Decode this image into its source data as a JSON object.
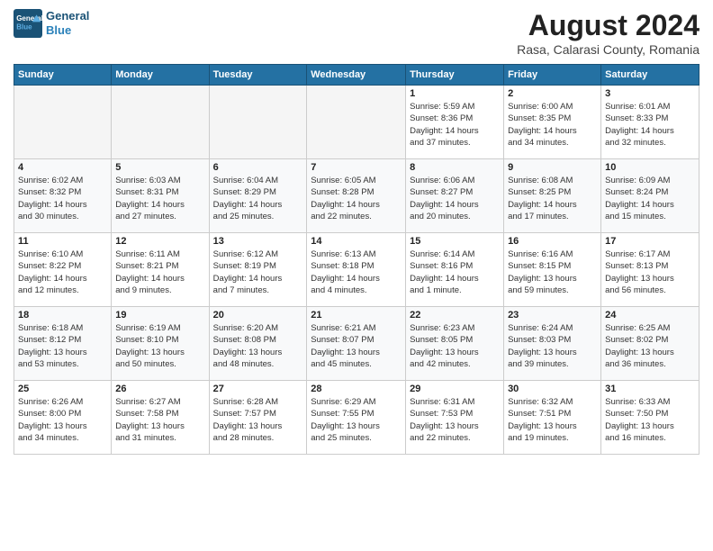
{
  "logo": {
    "line1": "General",
    "line2": "Blue"
  },
  "title": "August 2024",
  "location": "Rasa, Calarasi County, Romania",
  "days_header": [
    "Sunday",
    "Monday",
    "Tuesday",
    "Wednesday",
    "Thursday",
    "Friday",
    "Saturday"
  ],
  "weeks": [
    [
      {
        "num": "",
        "info": ""
      },
      {
        "num": "",
        "info": ""
      },
      {
        "num": "",
        "info": ""
      },
      {
        "num": "",
        "info": ""
      },
      {
        "num": "1",
        "info": "Sunrise: 5:59 AM\nSunset: 8:36 PM\nDaylight: 14 hours\nand 37 minutes."
      },
      {
        "num": "2",
        "info": "Sunrise: 6:00 AM\nSunset: 8:35 PM\nDaylight: 14 hours\nand 34 minutes."
      },
      {
        "num": "3",
        "info": "Sunrise: 6:01 AM\nSunset: 8:33 PM\nDaylight: 14 hours\nand 32 minutes."
      }
    ],
    [
      {
        "num": "4",
        "info": "Sunrise: 6:02 AM\nSunset: 8:32 PM\nDaylight: 14 hours\nand 30 minutes."
      },
      {
        "num": "5",
        "info": "Sunrise: 6:03 AM\nSunset: 8:31 PM\nDaylight: 14 hours\nand 27 minutes."
      },
      {
        "num": "6",
        "info": "Sunrise: 6:04 AM\nSunset: 8:29 PM\nDaylight: 14 hours\nand 25 minutes."
      },
      {
        "num": "7",
        "info": "Sunrise: 6:05 AM\nSunset: 8:28 PM\nDaylight: 14 hours\nand 22 minutes."
      },
      {
        "num": "8",
        "info": "Sunrise: 6:06 AM\nSunset: 8:27 PM\nDaylight: 14 hours\nand 20 minutes."
      },
      {
        "num": "9",
        "info": "Sunrise: 6:08 AM\nSunset: 8:25 PM\nDaylight: 14 hours\nand 17 minutes."
      },
      {
        "num": "10",
        "info": "Sunrise: 6:09 AM\nSunset: 8:24 PM\nDaylight: 14 hours\nand 15 minutes."
      }
    ],
    [
      {
        "num": "11",
        "info": "Sunrise: 6:10 AM\nSunset: 8:22 PM\nDaylight: 14 hours\nand 12 minutes."
      },
      {
        "num": "12",
        "info": "Sunrise: 6:11 AM\nSunset: 8:21 PM\nDaylight: 14 hours\nand 9 minutes."
      },
      {
        "num": "13",
        "info": "Sunrise: 6:12 AM\nSunset: 8:19 PM\nDaylight: 14 hours\nand 7 minutes."
      },
      {
        "num": "14",
        "info": "Sunrise: 6:13 AM\nSunset: 8:18 PM\nDaylight: 14 hours\nand 4 minutes."
      },
      {
        "num": "15",
        "info": "Sunrise: 6:14 AM\nSunset: 8:16 PM\nDaylight: 14 hours\nand 1 minute."
      },
      {
        "num": "16",
        "info": "Sunrise: 6:16 AM\nSunset: 8:15 PM\nDaylight: 13 hours\nand 59 minutes."
      },
      {
        "num": "17",
        "info": "Sunrise: 6:17 AM\nSunset: 8:13 PM\nDaylight: 13 hours\nand 56 minutes."
      }
    ],
    [
      {
        "num": "18",
        "info": "Sunrise: 6:18 AM\nSunset: 8:12 PM\nDaylight: 13 hours\nand 53 minutes."
      },
      {
        "num": "19",
        "info": "Sunrise: 6:19 AM\nSunset: 8:10 PM\nDaylight: 13 hours\nand 50 minutes."
      },
      {
        "num": "20",
        "info": "Sunrise: 6:20 AM\nSunset: 8:08 PM\nDaylight: 13 hours\nand 48 minutes."
      },
      {
        "num": "21",
        "info": "Sunrise: 6:21 AM\nSunset: 8:07 PM\nDaylight: 13 hours\nand 45 minutes."
      },
      {
        "num": "22",
        "info": "Sunrise: 6:23 AM\nSunset: 8:05 PM\nDaylight: 13 hours\nand 42 minutes."
      },
      {
        "num": "23",
        "info": "Sunrise: 6:24 AM\nSunset: 8:03 PM\nDaylight: 13 hours\nand 39 minutes."
      },
      {
        "num": "24",
        "info": "Sunrise: 6:25 AM\nSunset: 8:02 PM\nDaylight: 13 hours\nand 36 minutes."
      }
    ],
    [
      {
        "num": "25",
        "info": "Sunrise: 6:26 AM\nSunset: 8:00 PM\nDaylight: 13 hours\nand 34 minutes."
      },
      {
        "num": "26",
        "info": "Sunrise: 6:27 AM\nSunset: 7:58 PM\nDaylight: 13 hours\nand 31 minutes."
      },
      {
        "num": "27",
        "info": "Sunrise: 6:28 AM\nSunset: 7:57 PM\nDaylight: 13 hours\nand 28 minutes."
      },
      {
        "num": "28",
        "info": "Sunrise: 6:29 AM\nSunset: 7:55 PM\nDaylight: 13 hours\nand 25 minutes."
      },
      {
        "num": "29",
        "info": "Sunrise: 6:31 AM\nSunset: 7:53 PM\nDaylight: 13 hours\nand 22 minutes."
      },
      {
        "num": "30",
        "info": "Sunrise: 6:32 AM\nSunset: 7:51 PM\nDaylight: 13 hours\nand 19 minutes."
      },
      {
        "num": "31",
        "info": "Sunrise: 6:33 AM\nSunset: 7:50 PM\nDaylight: 13 hours\nand 16 minutes."
      }
    ]
  ]
}
